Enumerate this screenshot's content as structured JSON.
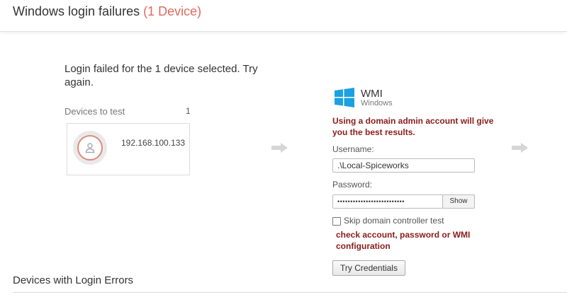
{
  "header": {
    "title": "Windows login failures",
    "count_label": "(1 Device)"
  },
  "login_message": "Login failed for the 1 device selected. Try again.",
  "devices_to_test": {
    "label": "Devices to test",
    "count": "1",
    "items": [
      {
        "ip": "192.168.100.133"
      }
    ]
  },
  "wmi": {
    "title": "WMI",
    "subtitle": "Windows",
    "advice": "Using a domain admin account will give you the best results.",
    "username_label": "Username:",
    "username_value": ".\\Local-Spiceworks",
    "password_label": "Password:",
    "password_mask": "••••••••••••••••••••••••••",
    "show_label": "Show",
    "skip_dc_label": "Skip domain controller test",
    "skip_dc_checked": false,
    "error_message": "check account, password or WMI configuration",
    "try_button_label": "Try Credentials"
  },
  "errors_section": {
    "heading": "Devices with Login Errors"
  },
  "colors": {
    "count_accent": "#e06a5c",
    "warning_text": "#8a1c1c",
    "windows_blue": "#1ba1e2"
  }
}
